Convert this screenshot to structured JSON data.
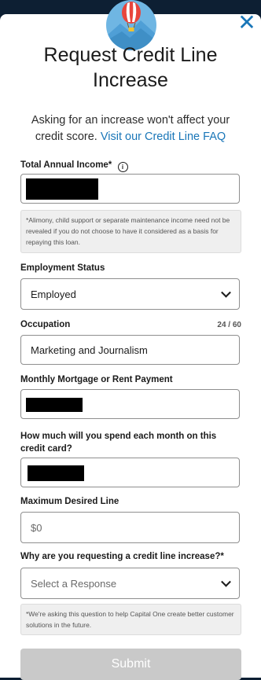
{
  "modal": {
    "title": "Request Credit Line Increase",
    "subtitle_text": "Asking for an increase won't affect your credit score.",
    "subtitle_link": "Visit our Credit Line FAQ",
    "close_symbol": "✕"
  },
  "form": {
    "income_label": "Total Annual Income*",
    "income_info_icon": "ⓘ",
    "income_note": "*Alimony, child support or separate maintenance income need not be revealed if you do not choose to have it considered as a basis for repaying this loan.",
    "employment_label": "Employment Status",
    "employment_value": "Employed",
    "occupation_label": "Occupation",
    "occupation_counter": "24 / 60",
    "occupation_value": "Marketing and Journalism",
    "mortgage_label": "Monthly Mortgage or Rent Payment",
    "spend_label": "How much will you spend each month on this credit card?",
    "max_line_label": "Maximum Desired Line",
    "max_line_placeholder": "$0",
    "reason_label": "Why are you requesting a credit line increase?*",
    "reason_placeholder": "Select a Response",
    "reason_note": "*We're asking this question to help Capital One create better customer solutions in the future.",
    "submit_label": "Submit"
  },
  "colors": {
    "link": "#1976b8",
    "submit_disabled": "#c9c9c9",
    "backdrop": "#0d1f33"
  },
  "icons": {
    "badge": "hot-air-balloon-icon",
    "close": "close-icon",
    "info": "info-icon",
    "select": "chevron-down-icon"
  }
}
